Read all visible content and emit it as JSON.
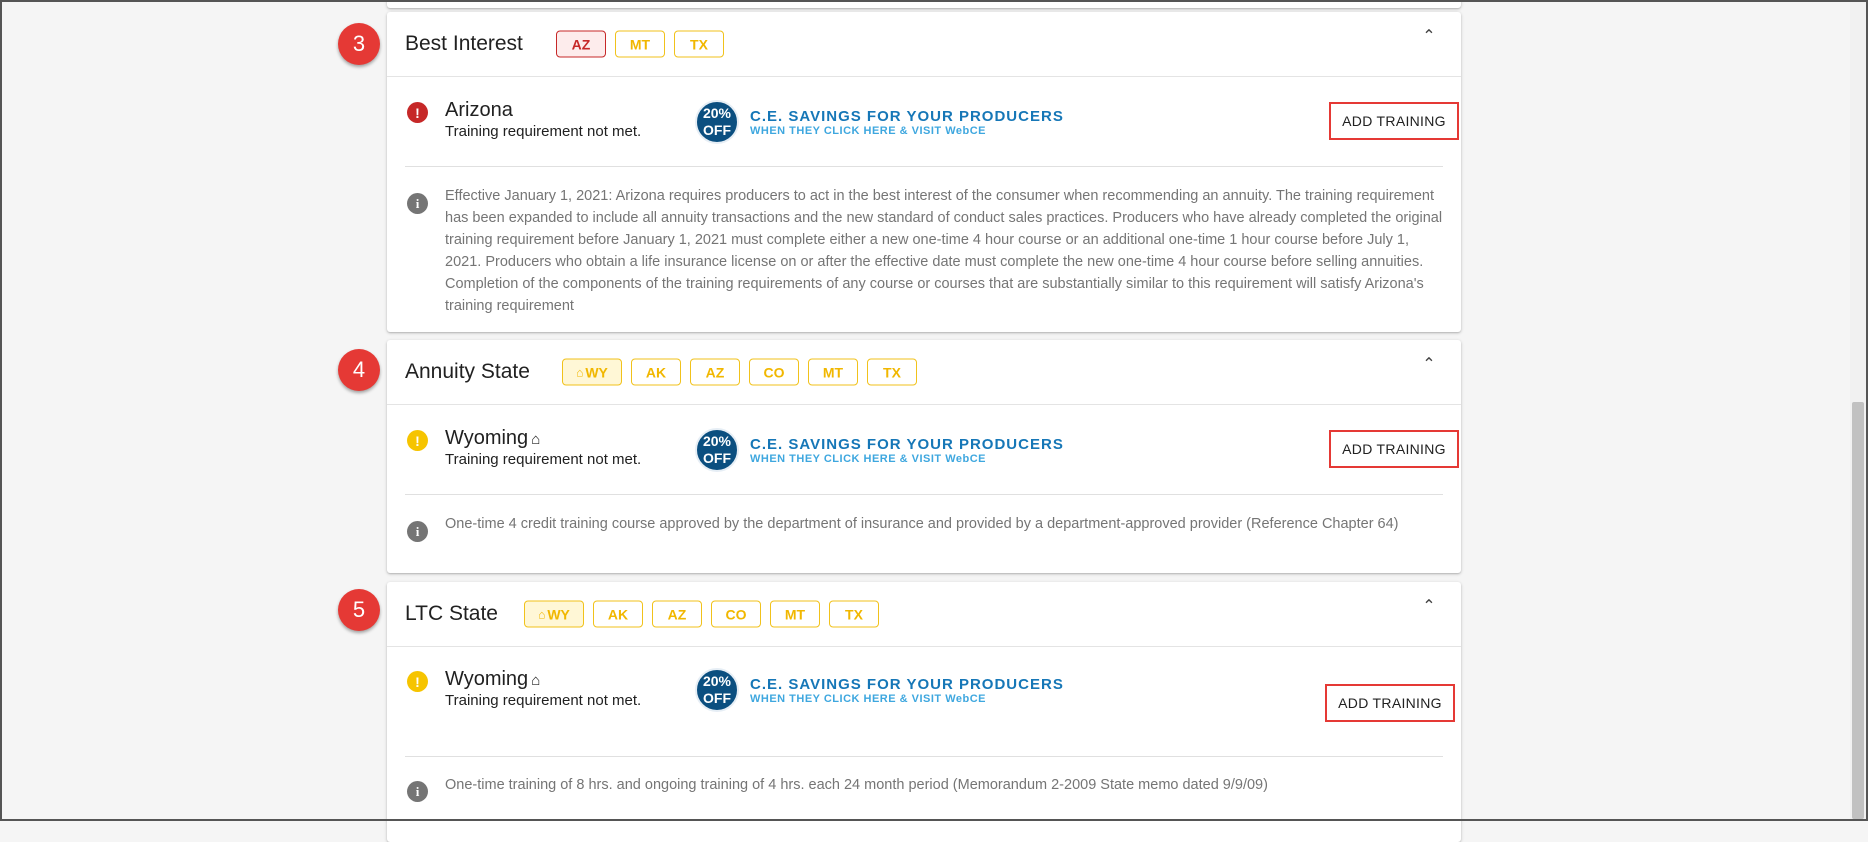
{
  "sections": [
    {
      "step": "3",
      "title": "Best Interest",
      "chips": [
        "AZ",
        "MT",
        "TX"
      ],
      "state": "Arizona",
      "status_msg": "Training requirement not met.",
      "info": "Effective January 1, 2021: Arizona requires producers to act in the best interest of the consumer when recommending an annuity. The training requirement has been expanded to include all annuity transactions and the new standard of conduct sales practices. Producers who have already completed the original training requirement before January 1, 2021 must complete either a new one-time 4 hour course or an additional one-time 1 hour course before July 1, 2021. Producers who obtain a life insurance license on or after the effective date must complete the new one-time 4 hour course before selling annuities. Completion of the components of the training requirements of any course or courses that are substantially similar to this requirement will satisfy Arizona's training requirement"
    },
    {
      "step": "4",
      "title": "Annuity State",
      "home_chip": "WY",
      "chips": [
        "AK",
        "AZ",
        "CO",
        "MT",
        "TX"
      ],
      "state": "Wyoming",
      "status_msg": "Training requirement not met.",
      "info": "One-time 4 credit training course approved by the department of insurance and provided by a department-approved provider (Reference Chapter 64)"
    },
    {
      "step": "5",
      "title": "LTC State",
      "home_chip": "WY",
      "chips": [
        "AK",
        "AZ",
        "CO",
        "MT",
        "TX"
      ],
      "state": "Wyoming",
      "status_msg": "Training requirement not met.",
      "info": "One-time training of 8 hrs. and ongoing training of 4 hrs. each 24 month period (Memorandum 2-2009 State memo dated 9/9/09)"
    }
  ],
  "promo": {
    "badge_line1": "20%",
    "badge_line2": "OFF",
    "title": "C.E. SAVINGS FOR YOUR PRODUCERS",
    "subtitle": "WHEN THEY CLICK HERE & VISIT WebCE"
  },
  "add_training_label": "ADD TRAINING",
  "icons": {
    "error": "error-icon",
    "warning": "warning-icon",
    "info": "info-icon",
    "home": "home-icon",
    "collapse": "chevron-up-icon"
  },
  "colors": {
    "error": "#c62828",
    "warning": "#f6c400",
    "chip_yellow": "#f1b700",
    "promo_blue": "#1677b7",
    "badge_blue": "#0b4f80",
    "highlight_red": "#e53935"
  }
}
